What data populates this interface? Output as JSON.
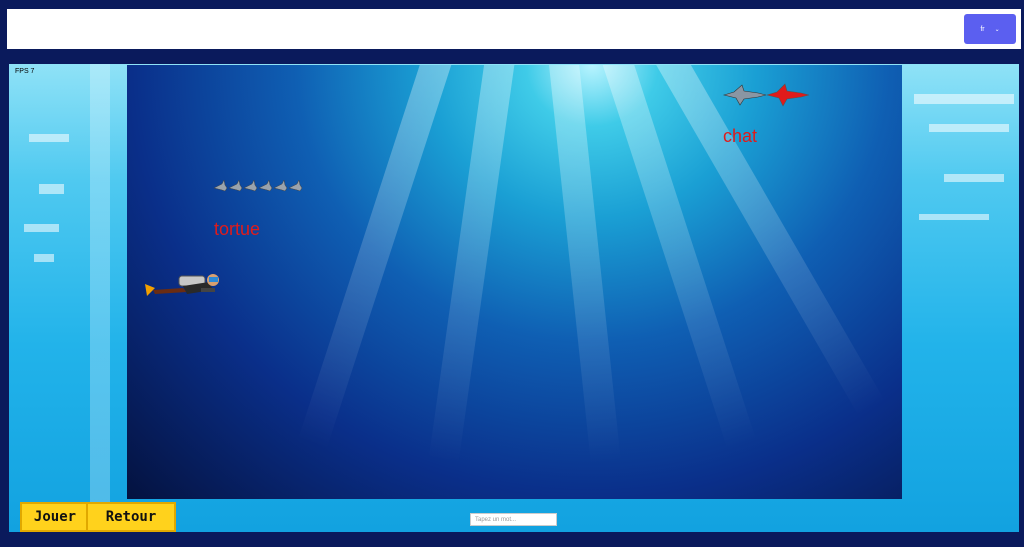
{
  "header": {
    "lang_label": "fr"
  },
  "hud": {
    "fps": "FPS 7"
  },
  "game": {
    "words": [
      {
        "text": "tortue"
      },
      {
        "text": "chat"
      }
    ]
  },
  "controls": {
    "play_label": "Jouer",
    "back_label": "Retour",
    "input_placeholder": "Tapez un mot..."
  },
  "colors": {
    "word": "#e01b1b",
    "button": "#ffd21c",
    "lang_button": "#5b5ff0"
  }
}
